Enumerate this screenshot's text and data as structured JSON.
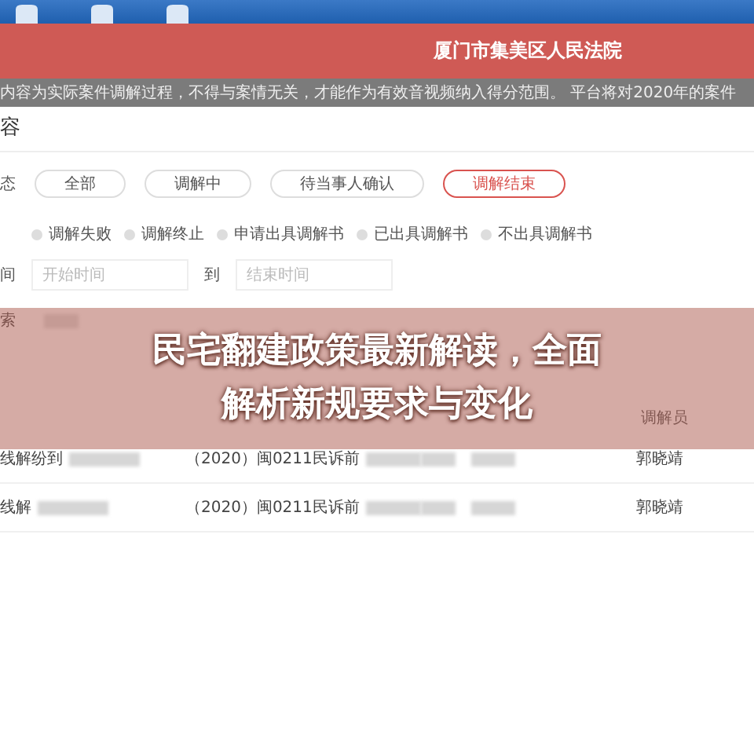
{
  "header": {
    "title": "厦门市集美区人民法院"
  },
  "notice": "内容为实际案件调解过程，不得与案情无关，才能作为有效音视频纳入得分范围。 平台将对2020年的案件",
  "section_title": "容",
  "filters": {
    "status_label": "态",
    "status_options": [
      {
        "label": "全部",
        "selected": false
      },
      {
        "label": "调解中",
        "selected": false
      },
      {
        "label": "待当事人确认",
        "selected": false
      },
      {
        "label": "调解结束",
        "selected": true
      }
    ],
    "result_options": [
      {
        "label": "调解失败",
        "selected": false
      },
      {
        "label": "调解终止",
        "selected": false
      },
      {
        "label": "申请出具调解书",
        "selected": false
      },
      {
        "label": "已出具调解书",
        "selected": false
      },
      {
        "label": "不出具调解书",
        "selected": false
      }
    ],
    "time_label": "间",
    "start": {
      "placeholder": "开始时间"
    },
    "to": "到",
    "end": {
      "placeholder": "结束时间"
    },
    "search_label": "索"
  },
  "table": {
    "columns": [
      {
        "label": "调解员"
      }
    ],
    "rows": [
      {
        "column_1": "线解纷到",
        "column_2": "（2020）闽0211民诉前",
        "mediator": "郭晓靖"
      },
      {
        "column_1": "线解",
        "column_2": "（2020）闽0211民诉前",
        "mediator": "郭晓靖"
      }
    ]
  },
  "overlay": {
    "title": "民宅翻建政策最新解读，全面解析新规要求与变化"
  }
}
